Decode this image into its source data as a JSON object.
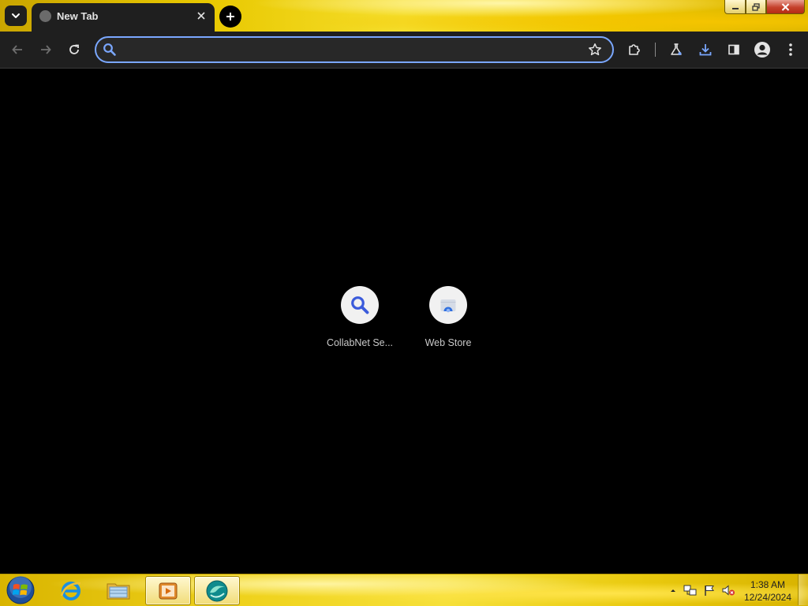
{
  "browser": {
    "tab": {
      "title": "New Tab"
    },
    "omnibox": {
      "value": "",
      "placeholder": ""
    },
    "accent_color": "#7aa7ff"
  },
  "toolbar": {
    "icons": [
      "back-icon",
      "forward-icon",
      "reload-icon",
      "bookmark-star-icon",
      "extensions-icon",
      "labs-flask-icon",
      "download-icon",
      "side-panel-icon",
      "profile-icon",
      "menu-icon"
    ]
  },
  "shortcuts": [
    {
      "label": "CollabNet Se...",
      "icon": "search-icon"
    },
    {
      "label": "Web Store",
      "icon": "web-store-icon"
    }
  ],
  "taskbar": {
    "apps": [
      "internet-explorer-icon",
      "file-explorer-icon",
      "media-player-icon",
      "browser-app-icon"
    ],
    "clock": {
      "time": "1:38 AM",
      "date": "12/24/2024"
    }
  }
}
